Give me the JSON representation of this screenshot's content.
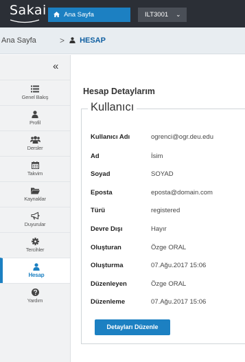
{
  "topbar": {
    "logo": "Sakai",
    "home_label": "Ana Sayfa",
    "site_label": "ILT3001",
    "site_chevron": "⌄"
  },
  "breadcrumb": {
    "home": "Ana Sayfa",
    "separator": ">",
    "current": "HESAP"
  },
  "sidebar": {
    "collapse_icon": "«",
    "items": [
      {
        "label": "Genel Bakış",
        "icon": "list-icon"
      },
      {
        "label": "Profil",
        "icon": "user-icon"
      },
      {
        "label": "Dersler",
        "icon": "users-icon"
      },
      {
        "label": "Takvim",
        "icon": "calendar-icon"
      },
      {
        "label": "Kaynaklar",
        "icon": "folder-icon"
      },
      {
        "label": "Duyurular",
        "icon": "bullhorn-icon"
      },
      {
        "label": "Tercihler",
        "icon": "gear-icon"
      },
      {
        "label": "Hesap",
        "icon": "user-icon",
        "active": true
      },
      {
        "label": "Yardım",
        "icon": "question-icon"
      }
    ]
  },
  "main": {
    "title": "Hesap Detaylarım",
    "legend": "Kullanıcı",
    "fields": [
      {
        "key": "Kullanıcı Adı",
        "value": "ogrenci@ogr.deu.edu"
      },
      {
        "key": "Ad",
        "value": "İsim"
      },
      {
        "key": "Soyad",
        "value": "SOYAD"
      },
      {
        "key": "Eposta",
        "value": "eposta@domain.com"
      },
      {
        "key": "Türü",
        "value": "registered"
      },
      {
        "key": "Devre Dışı",
        "value": "Hayır"
      },
      {
        "key": "Oluşturan",
        "value": "Özge ORAL"
      },
      {
        "key": "Oluşturma",
        "value": "07.Ağu.2017 15:06"
      },
      {
        "key": "Düzenleyen",
        "value": "Özge ORAL"
      },
      {
        "key": "Düzenleme",
        "value": "07.Ağu.2017 15:06"
      }
    ],
    "edit_button": "Detayları Düzenle"
  },
  "colors": {
    "topbar_bg": "#2b2f36",
    "accent": "#1c80c2",
    "breadcrumb_bg": "#e8edf1",
    "sidebar_bg": "#f1f2f3"
  }
}
